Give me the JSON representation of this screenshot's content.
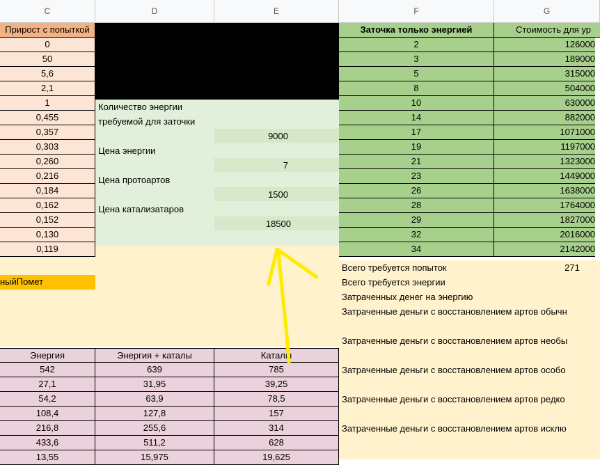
{
  "columns": [
    "C",
    "D",
    "E",
    "F",
    "G"
  ],
  "col_c": {
    "header": "Прирост с попыткой",
    "values": [
      "0",
      "50",
      "5,6",
      "2,1",
      "1",
      "0,455",
      "0,357",
      "0,303",
      "0,260",
      "0,216",
      "0,184",
      "0,162",
      "0,152",
      "0,130",
      "0,119"
    ]
  },
  "label_cell": "ныйПомет",
  "mid_labels": {
    "energy_needed_1": "Количество энергии",
    "energy_needed_2": "требуемой для заточки",
    "energy_needed_val": "9000",
    "energy_price": "Цена энергии",
    "energy_price_val": "7",
    "proto_price": "Цена протоартов",
    "proto_price_val": "1500",
    "catalyst_price": "Цена катализатаров",
    "catalyst_price_val": "18500"
  },
  "col_f": {
    "header": "Заточка только энергией",
    "values": [
      "2",
      "3",
      "5",
      "8",
      "10",
      "14",
      "17",
      "19",
      "21",
      "23",
      "26",
      "28",
      "29",
      "32",
      "34"
    ]
  },
  "col_g": {
    "header": "Стоимость для ур",
    "values": [
      "126000",
      "189000",
      "315000",
      "504000",
      "630000",
      "882000",
      "1071000",
      "1197000",
      "1323000",
      "1449000",
      "1638000",
      "1764000",
      "1827000",
      "2016000",
      "2142000"
    ]
  },
  "summary": {
    "attempts_label": "Всего требуется попыток",
    "attempts_value": "271",
    "energy_label": "Всего требуется энергии",
    "money_label": "Затраченных денег на энергию",
    "r1": "Затраченные деньги с восстановлением артов обычн",
    "r2": "Затраченные деньги с восстановлением артов необы",
    "r3": "Затраченные деньги с восстановлением артов особо",
    "r4": "Затраченные деньги с восстановлением артов редко",
    "r5": "Затраченные деньги с восстановлением артов исклю"
  },
  "bottom_table": {
    "headers": [
      "Энергия",
      "Энергия + каталы",
      "Каталы"
    ],
    "rows": [
      [
        "542",
        "639",
        "785"
      ],
      [
        "27,1",
        "31,95",
        "39,25"
      ],
      [
        "54,2",
        "63,9",
        "78,5"
      ],
      [
        "108,4",
        "127,8",
        "157"
      ],
      [
        "216,8",
        "255,6",
        "314"
      ],
      [
        "433,6",
        "511,2",
        "628"
      ],
      [
        "13,55",
        "15,975",
        "19,625"
      ]
    ]
  },
  "colors": {
    "peach": "#fce5d4",
    "green": "#a8d08d",
    "light_green": "#e2efda",
    "yellow": "#fff2cc",
    "pink": "#ead1dc",
    "orange": "#ffc000",
    "arrow": "#ffeb00"
  }
}
